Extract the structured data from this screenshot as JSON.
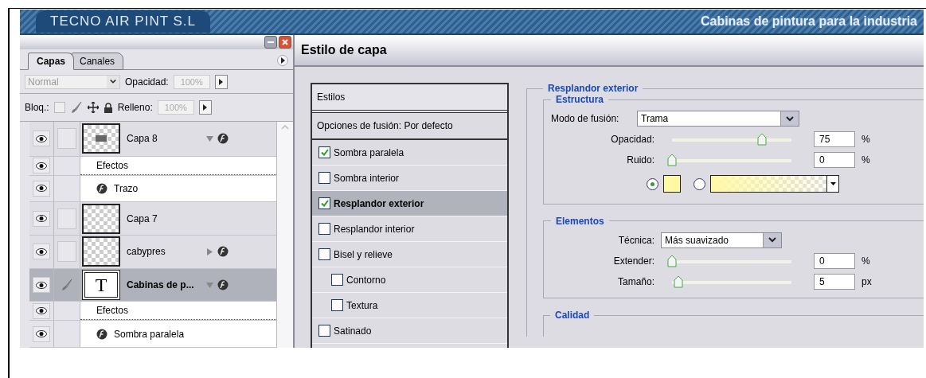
{
  "banner": {
    "company": "TECNO AIR PINT S.L",
    "slogan": "Cabinas de pintura para la industria"
  },
  "layers_panel": {
    "tabs": [
      {
        "label": "Capas",
        "selected": true
      },
      {
        "label": "Canales",
        "selected": false
      }
    ],
    "blend_mode": {
      "value": "Normal",
      "disabled": true
    },
    "opacity": {
      "label": "Opacidad:",
      "value": "100%"
    },
    "lock": {
      "label": "Bloq.:"
    },
    "fill": {
      "label": "Relleno:",
      "value": "100%"
    },
    "rows": [
      {
        "kind": "layer",
        "name": "Capa 8",
        "thumbnail": {
          "kind": "image"
        },
        "visible": true,
        "selected": false,
        "brush": false,
        "effects": true,
        "expanded": true
      },
      {
        "kind": "effects",
        "label": "Efectos",
        "visible": true
      },
      {
        "kind": "effect",
        "name": "Trazo",
        "visible": true
      },
      {
        "kind": "layer",
        "name": "Capa 7",
        "thumbnail": {
          "kind": "empty"
        },
        "visible": true,
        "selected": false,
        "brush": false,
        "effects": false
      },
      {
        "kind": "layer",
        "name": "cabypres",
        "thumbnail": {
          "kind": "empty"
        },
        "visible": true,
        "selected": false,
        "brush": false,
        "effects": true,
        "expanded": false
      },
      {
        "kind": "layer",
        "name": "Cabinas de p...",
        "thumbnail": {
          "kind": "text",
          "label": "T"
        },
        "visible": true,
        "selected": true,
        "brush": true,
        "effects": true,
        "expanded": true
      },
      {
        "kind": "effects",
        "label": "Efectos",
        "visible": true
      },
      {
        "kind": "effect",
        "name": "Sombra paralela",
        "visible": true
      }
    ]
  },
  "dialog": {
    "title": "Estilo de capa",
    "styles_header": "Estilos",
    "blending_options": "Opciones de fusión: Por defecto",
    "styles": [
      {
        "label": "Sombra paralela",
        "checked": true,
        "selected": false
      },
      {
        "label": "Sombra interior",
        "checked": false,
        "selected": false
      },
      {
        "label": "Resplandor exterior",
        "checked": true,
        "selected": true
      },
      {
        "label": "Resplandor interior",
        "checked": false,
        "selected": false
      },
      {
        "label": "Bisel y relieve",
        "checked": false,
        "selected": false,
        "children": [
          {
            "label": "Contorno",
            "checked": false,
            "selected": false
          },
          {
            "label": "Textura",
            "checked": false,
            "selected": false
          }
        ]
      },
      {
        "label": "Satinado",
        "checked": false,
        "selected": false
      }
    ],
    "section_title": "Resplandor exterior",
    "structure": {
      "title": "Estructura",
      "blend_mode": {
        "label": "Modo de fusión:",
        "value": "Trama"
      },
      "sliders": [
        {
          "label": "Opacidad:",
          "level": 0.75,
          "value": "75",
          "unit": "%"
        },
        {
          "label": "Ruido:",
          "level": 0,
          "value": "0",
          "unit": "%"
        }
      ],
      "fill_choices": [
        {
          "kind": "color",
          "selected": true
        },
        {
          "kind": "gradient",
          "selected": false
        }
      ]
    },
    "elements": {
      "title": "Elementos",
      "technique": {
        "label": "Técnica:",
        "value": "Más suavizado"
      },
      "sliders": [
        {
          "label": "Extender:",
          "level": 0,
          "value": "0",
          "unit": "%"
        },
        {
          "label": "Tamaño:",
          "level": 0.05,
          "value": "5",
          "unit": "px"
        }
      ]
    },
    "quality": {
      "title": "Calidad"
    }
  }
}
